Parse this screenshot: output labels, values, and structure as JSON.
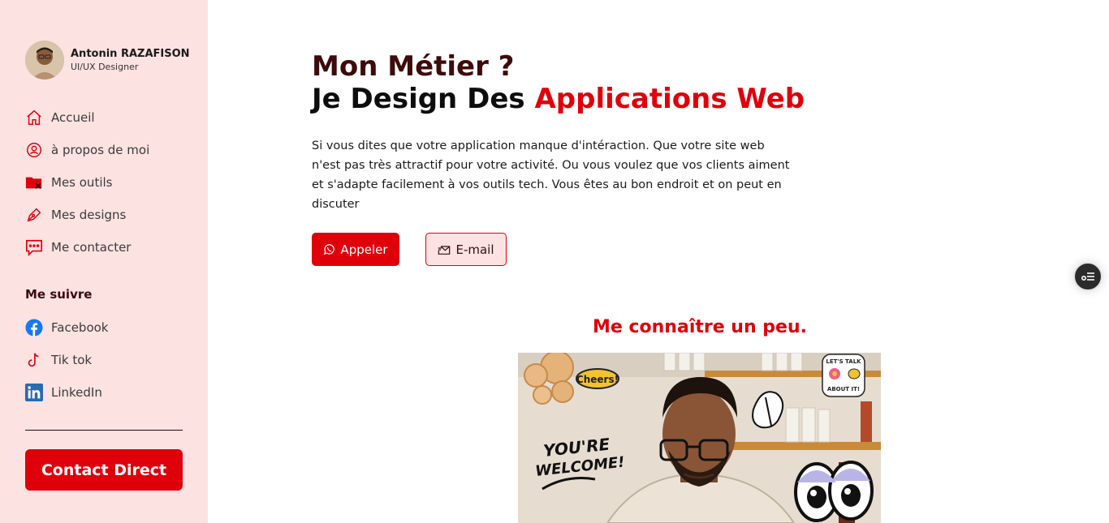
{
  "profile": {
    "name": "Antonin RAZAFISON",
    "role": "UI/UX Designer"
  },
  "nav": [
    {
      "label": "Accueil",
      "icon": "home-icon"
    },
    {
      "label": "à propos de moi",
      "icon": "user-circle-icon"
    },
    {
      "label": "Mes outils",
      "icon": "folder-tools-icon"
    },
    {
      "label": "Mes designs",
      "icon": "pen-icon"
    },
    {
      "label": "Me contacter",
      "icon": "chat-icon"
    }
  ],
  "follow": {
    "title": "Me suivre",
    "items": [
      {
        "label": "Facebook",
        "icon": "facebook-icon"
      },
      {
        "label": "Tik tok",
        "icon": "tiktok-icon"
      },
      {
        "label": "LinkedIn",
        "icon": "linkedin-icon"
      }
    ]
  },
  "contact_direct_label": "Contact Direct",
  "hero": {
    "title_line1": "Mon Métier ?",
    "title_line2_prefix": "Je Design Des",
    "title_line2_accent": "Applications Web",
    "description": "Si vous dites que votre application manque d'intéraction. Que votre site web n'est pas très attractif pour votre activité. Ou vous voulez que vos clients aiment et s'adapte facilement à vos outils tech. Vous êtes au bon endroit et on peut en discuter",
    "call_label": "Appeler",
    "mail_label": "E-mail"
  },
  "about": {
    "title": "Me connaître un peu.",
    "stickers": {
      "welcome_line1": "YOU'RE",
      "welcome_line2": "WELCOME!",
      "talk_line1": "LET'S TALK",
      "talk_line2": "ABOUT IT!",
      "cheers": "Cheers!"
    }
  },
  "colors": {
    "accent": "#e0000a",
    "sidebar_bg": "#fde2e2",
    "dark_red": "#3e0a0a"
  }
}
